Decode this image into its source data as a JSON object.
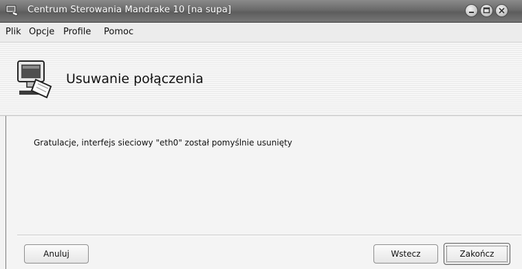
{
  "window": {
    "title": "Centrum Sterowania Mandrake 10 [na supa]"
  },
  "menubar": {
    "items": [
      {
        "label": "Plik"
      },
      {
        "label": "Opcje"
      },
      {
        "label": "Profile"
      },
      {
        "label": "Pomoc"
      }
    ]
  },
  "header": {
    "title": "Usuwanie połączenia",
    "icon": "network-computer-icon"
  },
  "content": {
    "message": "Gratulacje, interfejs sieciowy \"eth0\" został pomyślnie usunięty"
  },
  "buttons": {
    "cancel_label": "Anuluj",
    "back_label": "Wstecz",
    "finish_label": "Zakończ"
  }
}
